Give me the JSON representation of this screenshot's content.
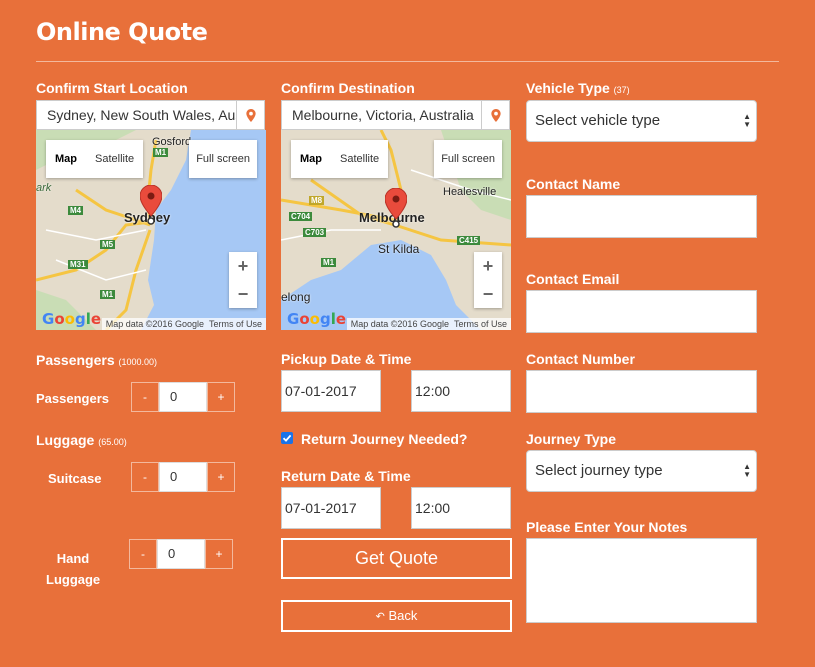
{
  "header": {
    "title": "Online Quote"
  },
  "start": {
    "label": "Confirm Start Location",
    "value": "Sydney, New South Wales, Australia",
    "map": {
      "tab_map": "Map",
      "tab_satellite": "Satellite",
      "fullscreen": "Full screen",
      "zoom_in": "+",
      "zoom_out": "−",
      "city": "Sydney",
      "places": [
        "Gosford",
        "ark"
      ],
      "roads": [
        "M4",
        "M5",
        "M31",
        "M1",
        "M1"
      ],
      "attribution": "Map data ©2016 Google",
      "terms": "Terms of Use",
      "logo": "Google"
    }
  },
  "destination": {
    "label": "Confirm Destination",
    "value": "Melbourne, Victoria, Australia",
    "map": {
      "tab_map": "Map",
      "tab_satellite": "Satellite",
      "fullscreen": "Full screen",
      "zoom_in": "+",
      "zoom_out": "−",
      "city": "Melbourne",
      "places": [
        "Healesville",
        "St Kilda",
        "elong"
      ],
      "roads": [
        "M8",
        "C704",
        "C703",
        "M1",
        "C415"
      ],
      "attribution": "Map data ©2016 Google",
      "terms": "Terms of Use",
      "logo": "Google"
    }
  },
  "passengers": {
    "heading": "Passengers",
    "heading_sub": "(1000.00)",
    "row_label": "Passengers",
    "value": "0",
    "minus": "-",
    "plus": "+"
  },
  "luggage": {
    "heading": "Luggage",
    "heading_sub": "(65.00)",
    "suitcase_label": "Suitcase",
    "suitcase_value": "0",
    "hand_label_1": "Hand",
    "hand_label_2": "Luggage",
    "hand_value": "0",
    "minus": "-",
    "plus": "+"
  },
  "pickup": {
    "label": "Pickup Date & Time",
    "date": "07-01-2017",
    "time": "12:00"
  },
  "return_needed": {
    "label": "Return Journey Needed?",
    "checked": true
  },
  "return_dt": {
    "label": "Return Date & Time",
    "date": "07-01-2017",
    "time": "12:00"
  },
  "actions": {
    "get_quote": "Get Quote",
    "back": "Back"
  },
  "vehicle": {
    "label": "Vehicle Type",
    "label_sub": "(37)",
    "placeholder": "Select vehicle type"
  },
  "contact_name": {
    "label": "Contact Name",
    "value": ""
  },
  "contact_email": {
    "label": "Contact Email",
    "value": ""
  },
  "contact_number": {
    "label": "Contact Number",
    "value": ""
  },
  "journey": {
    "label": "Journey Type",
    "placeholder": "Select journey type"
  },
  "notes": {
    "label": "Please Enter Your Notes",
    "value": ""
  },
  "colors": {
    "background": "#e8703a",
    "map_water": "#a6c8f5",
    "map_land": "#e4dccb",
    "pin": "#e94b3c"
  },
  "icons": [
    "map-marker-icon",
    "map-pin-icon",
    "checkbox-checked-icon",
    "select-arrows-icon",
    "back-arrow-icon"
  ]
}
